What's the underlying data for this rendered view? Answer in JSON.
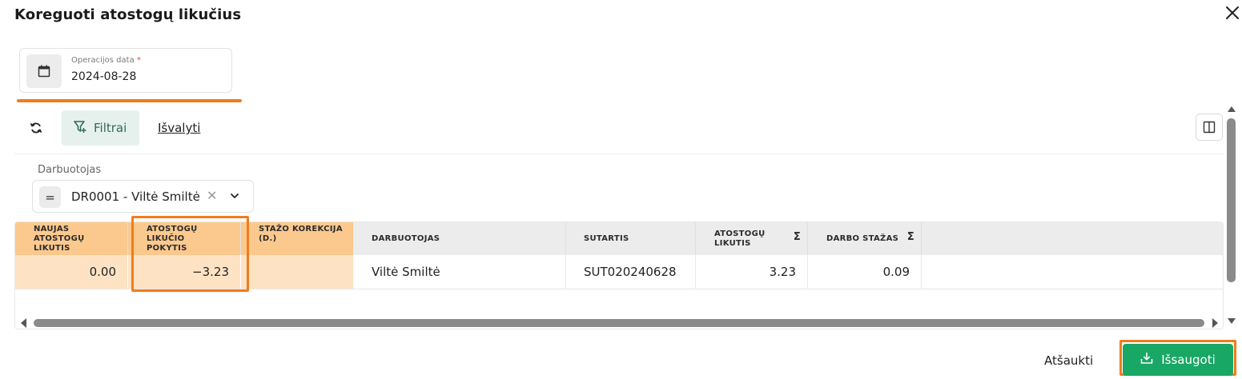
{
  "dialog": {
    "title": "Koreguoti atostogų likučius",
    "close_icon": "close-icon"
  },
  "operation_date": {
    "label": "Operacijos data",
    "required_mark": "*",
    "value": "2024-08-28",
    "icon": "calendar-icon"
  },
  "toolbar": {
    "refresh_icon": "refresh-icon",
    "filters_label": "Filtrai",
    "filters_icon": "filter-plus-icon",
    "clear_label": "Išvalyti",
    "columns_icon": "columns-icon"
  },
  "filter": {
    "label": "Darbuotojas",
    "operator": "=",
    "value": "DR0001 - Viltė Smiltė",
    "clear_glyph": "✕"
  },
  "table": {
    "columns": [
      {
        "label": "NAUJAS ATOSTOGŲ LIKUTIS",
        "editable": true
      },
      {
        "label": "ATOSTOGŲ LIKUČIO POKYTIS",
        "editable": true
      },
      {
        "label": "STAŽO KOREKCIJA (D.)",
        "editable": true
      },
      {
        "label": "DARBUOTOJAS",
        "editable": false
      },
      {
        "label": "SUTARTIS",
        "editable": false
      },
      {
        "label": "ATOSTOGŲ LIKUTIS",
        "editable": false,
        "sum": "Σ"
      },
      {
        "label": "DARBO STAŽAS",
        "editable": false,
        "sum": "Σ"
      }
    ],
    "rows": [
      {
        "new_balance": "0.00",
        "balance_change": "−3.23",
        "seniority_correction": "",
        "employee": "Viltė Smiltė",
        "contract": "SUT020240628",
        "vacation_balance": "3.23",
        "work_seniority": "0.09"
      }
    ]
  },
  "footer": {
    "cancel_label": "Atšaukti",
    "save_label": "Išsaugoti",
    "save_icon": "download-icon"
  },
  "colors": {
    "accent_green": "#19a765",
    "highlight_orange": "#f07d1c",
    "editable_header": "#fbc98e",
    "editable_cell": "#fde3c3",
    "filter_button_bg": "#e6f1ed"
  }
}
